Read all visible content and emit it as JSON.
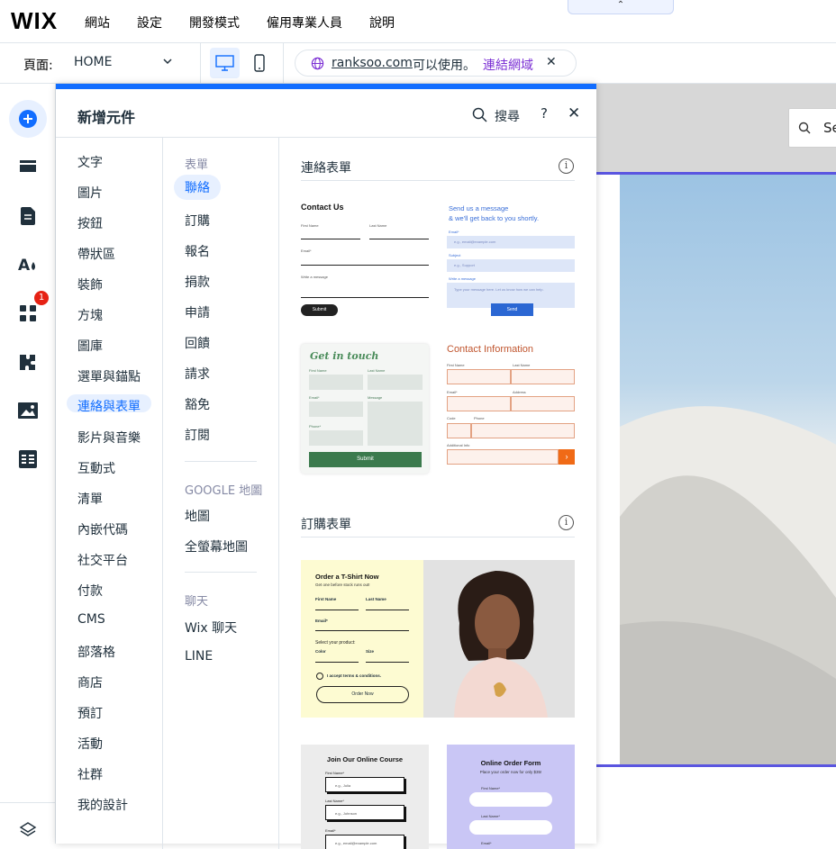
{
  "topbar": {
    "logo": "WIX",
    "menu": [
      "網站",
      "設定",
      "開發模式",
      "僱用專業人員",
      "說明"
    ],
    "collapse_icon": "chevron-up-icon"
  },
  "secondbar": {
    "page_label": "頁面:",
    "page_value": "HOME",
    "url_domain": "ranksoo.com",
    "url_status": "可以使用。",
    "url_link": "連結網域"
  },
  "leftrail": {
    "badge": "1"
  },
  "panel": {
    "title": "新增元件",
    "search_label": "搜尋",
    "help": "?",
    "categories": [
      "文字",
      "圖片",
      "按鈕",
      "帶狀區",
      "裝飾",
      "方塊",
      "圖庫",
      "選單與錨點",
      "連絡與表單",
      "影片與音樂",
      "互動式",
      "清單",
      "內嵌代碼",
      "社交平台",
      "付款",
      "CMS",
      "部落格",
      "商店",
      "預訂",
      "活動",
      "社群",
      "我的設計"
    ],
    "active_category": "連絡與表單",
    "forms_header": "表單",
    "forms": [
      "聯絡",
      "訂購",
      "報名",
      "捐款",
      "申請",
      "回饋",
      "請求",
      "豁免",
      "訂閱"
    ],
    "maps_header": "GOOGLE 地圖",
    "maps": [
      "地圖",
      "全螢幕地圖"
    ],
    "chat_header": "聊天",
    "chat": [
      "Wix 聊天",
      "LINE"
    ],
    "section_contact": "連絡表單",
    "section_order": "訂購表單"
  },
  "templates": {
    "t1": {
      "title": "Contact Us",
      "first": "First Name",
      "last": "Last Name",
      "email": "Email*",
      "message": "Write a message",
      "button": "Submit"
    },
    "t2": {
      "title1": "Send us a message",
      "title2": "& we'll get back to you shortly.",
      "email": "Email*",
      "email_ph": "e.g., email@example.com",
      "subject": "Subject",
      "subject_ph": "e.g., Support",
      "message": "Write a message",
      "message_ph": "Type your message here. Let us know how we can help.",
      "button": "Send"
    },
    "t3": {
      "title": "Get in touch",
      "first": "First Name",
      "last": "Last Name",
      "email": "Email*",
      "message": "Message",
      "phone": "Phone*",
      "button": "Submit"
    },
    "t4": {
      "title": "Contact Information",
      "first": "First Name",
      "last": "Last Name",
      "email": "Email*",
      "address": "Address",
      "code": "Code",
      "phone": "Phone",
      "additional": "Additional Info",
      "arrow": "›"
    },
    "t5": {
      "title": "Order a T-Shirt Now",
      "subtitle": "Get one before stock runs out!",
      "first": "First Name",
      "last": "Last Name",
      "email": "Email*",
      "select": "Select your product:",
      "color": "Color",
      "size": "Size",
      "terms": "I accept terms & conditions.",
      "button": "Order Now"
    },
    "t6": {
      "title": "Join Our Online Course",
      "first": "First Name*",
      "first_ph": "e.g., Julia",
      "last": "Last Name*",
      "last_ph": "e.g., Johnson",
      "email": "Email*",
      "email_ph": "e.g., email@example.com"
    },
    "t7": {
      "title": "Online Order Form",
      "subtitle": "Place your order now for only $35!",
      "first": "First Name*",
      "last": "Last Name*",
      "email": "Email*"
    }
  },
  "colors": {
    "accent": "#116dff",
    "active_bg": "#e7f0ff",
    "domain_link": "#7b2fd4",
    "canvas_line": "#5a55e0",
    "badge": "#e62214"
  }
}
